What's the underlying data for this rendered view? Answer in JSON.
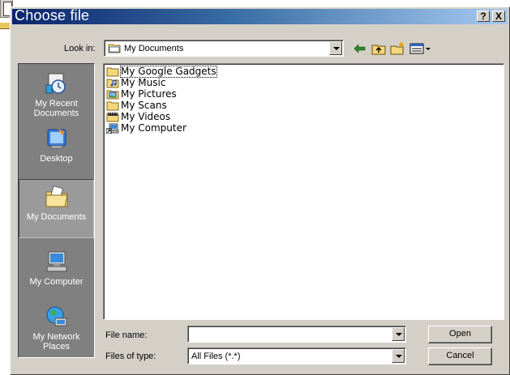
{
  "dialog": {
    "title": "Choose file",
    "help_glyph": "?",
    "close_glyph": "X"
  },
  "look_in": {
    "label": "Look in:",
    "value": "My Documents",
    "icon": "folder-icon"
  },
  "toolbar": {
    "back_icon": "back-arrow-icon",
    "up_icon": "up-folder-icon",
    "new_folder_icon": "new-folder-icon",
    "view_icon": "view-menu-icon"
  },
  "places": [
    {
      "label": "My Recent Documents",
      "icon": "recent-documents-icon"
    },
    {
      "label": "Desktop",
      "icon": "desktop-icon"
    },
    {
      "label": "My Documents",
      "icon": "my-documents-icon",
      "selected": true
    },
    {
      "label": "My Computer",
      "icon": "my-computer-icon"
    },
    {
      "label": "My Network Places",
      "icon": "network-places-icon"
    }
  ],
  "files": [
    {
      "name": "My Google Gadgets",
      "icon": "folder-icon",
      "focused": true
    },
    {
      "name": "My Music",
      "icon": "music-folder-icon"
    },
    {
      "name": "My Pictures",
      "icon": "pictures-folder-icon"
    },
    {
      "name": "My Scans",
      "icon": "folder-icon"
    },
    {
      "name": "My Videos",
      "icon": "videos-folder-icon"
    },
    {
      "name": "My Computer",
      "icon": "computer-shortcut-icon"
    }
  ],
  "file_name": {
    "label": "File name:",
    "value": ""
  },
  "file_type": {
    "label": "Files of type:",
    "value": "All Files (*.*)"
  },
  "buttons": {
    "open": "Open",
    "cancel": "Cancel"
  }
}
